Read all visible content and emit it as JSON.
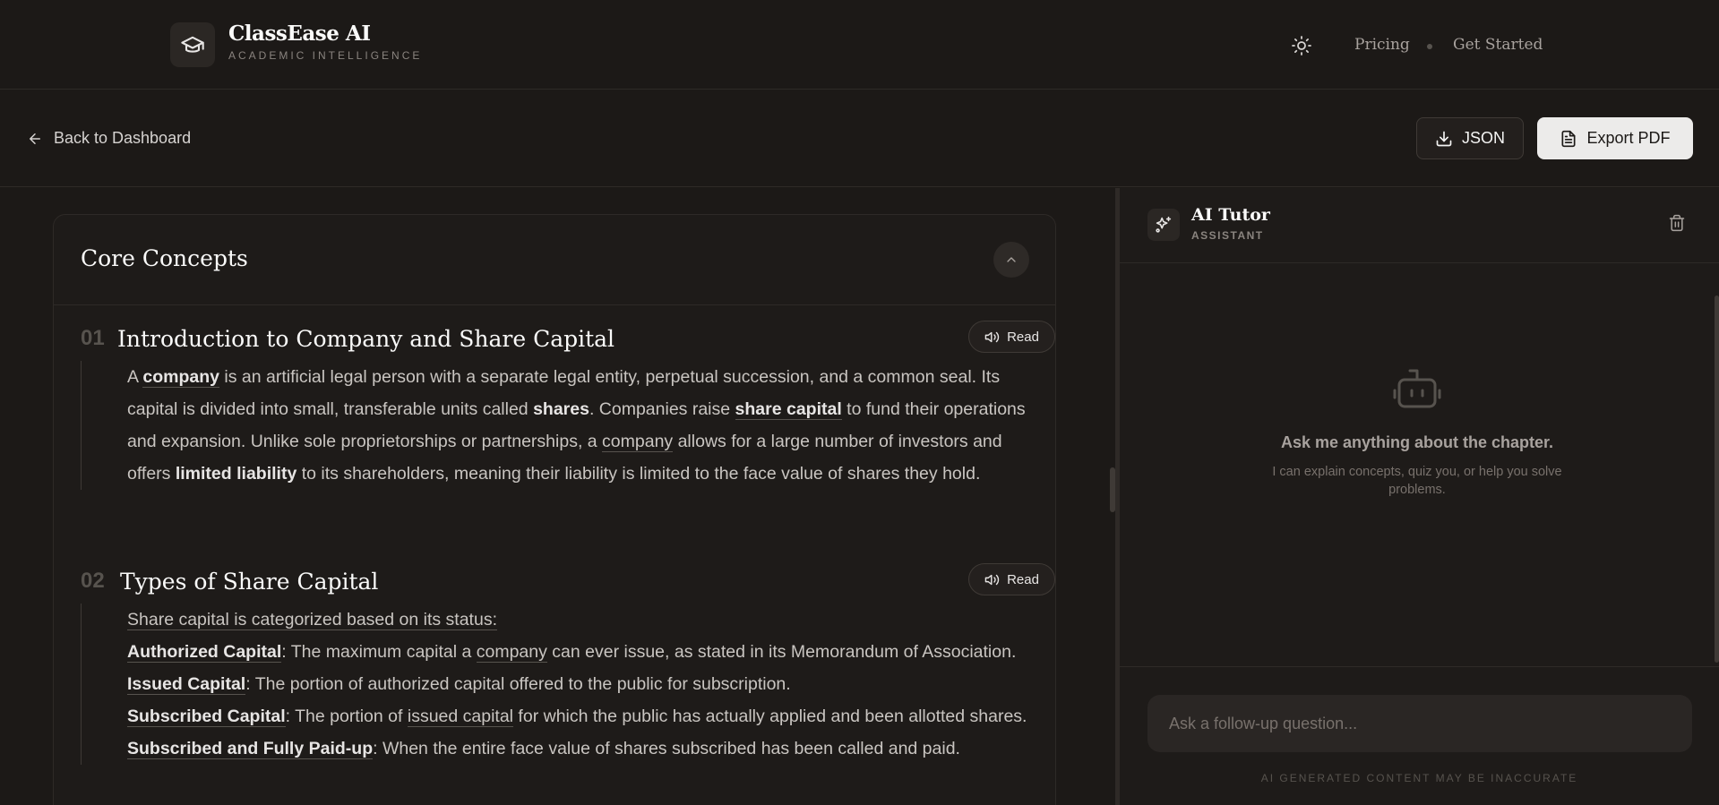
{
  "brand": {
    "name": "ClassEase AI",
    "tagline": "ACADEMIC INTELLIGENCE"
  },
  "nav": {
    "pricing": "Pricing",
    "get_started": "Get Started"
  },
  "toolbar": {
    "back_label": "Back to Dashboard",
    "json_label": "JSON",
    "pdf_label": "Export PDF"
  },
  "card": {
    "title": "Core Concepts"
  },
  "sections": [
    {
      "num": "01",
      "title": "Introduction to Company and Share Capital",
      "read_label": "Read",
      "p": [
        "A ",
        "company",
        " is an artificial legal person with a separate legal entity, perpetual succession, and a common seal. Its capital is divided into small, transferable units called ",
        "shares",
        ". Companies raise ",
        "share capital",
        " to fund their operations and expansion. Unlike sole proprietorships or partnerships, a ",
        "company",
        " allows for a large number of investors and offers ",
        "limited liability",
        " to its shareholders, meaning their liability is limited to the face value of shares they hold."
      ]
    },
    {
      "num": "02",
      "title": "Types of Share Capital",
      "read_label": "Read",
      "intro": "Share capital is categorized based on its status:",
      "items": [
        {
          "term": "Authorized Capital",
          "text_a": ": The maximum capital a ",
          "link": "company",
          "text_b": " can ever issue, as stated in its Memorandum of Association."
        },
        {
          "term": "Issued Capital",
          "text_a": ": The portion of authorized capital offered to the public for subscription."
        },
        {
          "term": "Subscribed Capital",
          "text_a": ": The portion of ",
          "link": "issued capital",
          "text_b": " for which the public has actually applied and been allotted shares."
        },
        {
          "term": "Subscribed and Fully Paid-up",
          "text_a": ": When the entire face value of shares subscribed has been called and paid."
        }
      ]
    }
  ],
  "tutor": {
    "name": "AI Tutor",
    "role": "ASSISTANT",
    "empty_title": "Ask me anything about the chapter.",
    "empty_sub": "I can explain concepts, quiz you, or help you solve problems.",
    "input_placeholder": "Ask a follow-up question...",
    "disclaimer": "AI GENERATED CONTENT MAY BE INACCURATE"
  }
}
